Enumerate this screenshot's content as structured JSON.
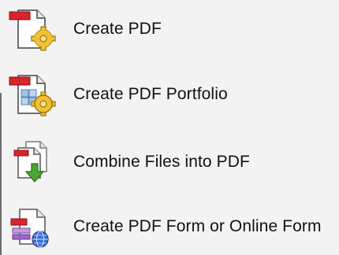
{
  "menu": {
    "items": [
      {
        "label": "Create PDF",
        "icon": "create-pdf-icon"
      },
      {
        "label": "Create PDF Portfolio",
        "icon": "create-pdf-portfolio-icon"
      },
      {
        "label": "Combine Files into PDF",
        "icon": "combine-files-icon"
      },
      {
        "label": "Create PDF Form or Online Form",
        "icon": "create-pdf-form-icon"
      }
    ]
  },
  "colors": {
    "background": "#f3f3f3",
    "text": "#111111",
    "pdf_red": "#d8242b",
    "gear_gold": "#f1c232",
    "arrow_green": "#4aa82f",
    "globe_blue": "#3b6fd0",
    "portfolio_blue": "#9fc3e6",
    "form_purple": "#a066c8"
  }
}
